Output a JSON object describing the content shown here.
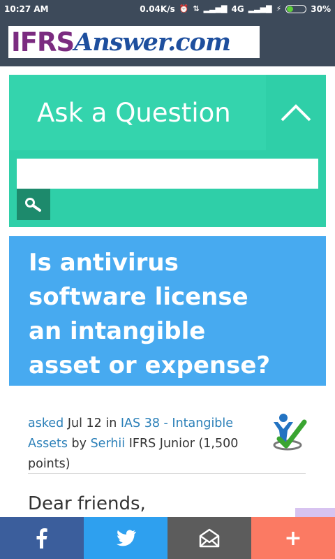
{
  "status_bar": {
    "time": "10:27 AM",
    "network_speed": "0.04K/s",
    "network_type": "4G",
    "battery_percent": "30%",
    "battery_level": 0.3
  },
  "header": {
    "logo_part1": "IFRS",
    "logo_part2": "Answer.com"
  },
  "ask": {
    "title": "Ask a Question",
    "search_value": "",
    "toggle_icon": "chevron-up-icon",
    "search_icon": "search-icon"
  },
  "question": {
    "title_lines": [
      "Is antivirus",
      "software license",
      "an intangible",
      "asset or expense?"
    ]
  },
  "meta": {
    "asked_label": "asked",
    "date": "Jul 12",
    "in_label": "in",
    "category": "IAS 38 - Intangible Assets",
    "by_label": "by",
    "author": "Serhii",
    "author_rank": "IFRS Junior (1,500 points)"
  },
  "body": {
    "greeting": "Dear friends,"
  },
  "share_bar": {
    "facebook_icon": "facebook-icon",
    "twitter_icon": "twitter-icon",
    "email_icon": "email-icon",
    "more_label": "+"
  },
  "colors": {
    "header_bg": "#3d4a5a",
    "ask_panel": "#2fcfa8",
    "search_button": "#1d8a6c",
    "question_bg": "#47aaf0",
    "link": "#2a7fb8",
    "facebook": "#3b5e9c",
    "twitter": "#2ea0ef",
    "email": "#5c5c5c",
    "more": "#fb7a63"
  }
}
